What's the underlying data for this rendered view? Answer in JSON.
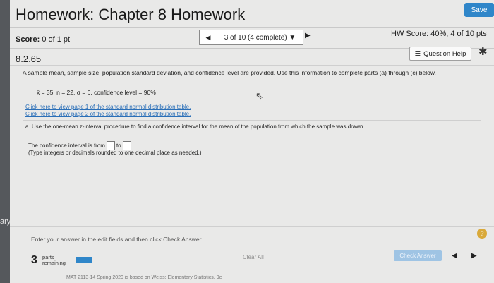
{
  "sidebar": {
    "partial_word": "ary"
  },
  "header": {
    "title": "Homework: Chapter 8 Homework",
    "save_label": "Save"
  },
  "score": {
    "label": "Score:",
    "value": "0 of 1 pt"
  },
  "pager": {
    "prev_icon": "◀",
    "text": "3 of 10 (4 complete)",
    "dropdown_icon": "▼",
    "next_icon": "▶"
  },
  "hw_score": "HW Score: 40%, 4 of 10 pts",
  "question": {
    "number": "8.2.65",
    "help_label": "Question Help",
    "help_icon": "☰",
    "gear_icon": "✱",
    "text": "A sample mean, sample size, population standard deviation, and confidence level are provided. Use this information to complete parts (a) through (c) below.",
    "given": "x̄ = 35, n = 22, σ = 6, confidence level = 90%",
    "link1": "Click here to view page 1 of the standard normal distribution table.",
    "link2": "Click here to view page 2 of the standard normal distribution table.",
    "part_a": "a. Use the one-mean z-interval procedure to find a confidence interval for the mean of the population from which the sample was drawn.",
    "interval_prefix": "The confidence interval is from",
    "interval_to": "to",
    "hint": "(Type integers or decimals rounded to one decimal place as needed.)"
  },
  "bottom": {
    "instruction": "Enter your answer in the edit fields and then click Check Answer.",
    "help_icon": "?",
    "parts_count": "3",
    "parts_label_1": "parts",
    "parts_label_2": "remaining",
    "clear_all": "Clear All",
    "check_answer": "Check Answer",
    "nav_prev": "◀",
    "nav_next": "▶",
    "footer": "MAT 2113-14 Spring 2020 is based on Weiss: Elementary Statistics, 9e"
  },
  "colors": {
    "accent": "#2f86c9",
    "link": "#2a6fb8"
  }
}
